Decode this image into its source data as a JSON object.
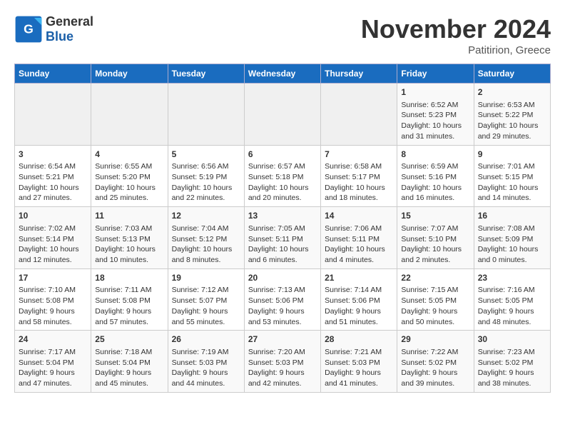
{
  "header": {
    "logo_general": "General",
    "logo_blue": "Blue",
    "month_title": "November 2024",
    "subtitle": "Patitirion, Greece"
  },
  "weekdays": [
    "Sunday",
    "Monday",
    "Tuesday",
    "Wednesday",
    "Thursday",
    "Friday",
    "Saturday"
  ],
  "weeks": [
    [
      {
        "day": "",
        "info": "",
        "empty": true
      },
      {
        "day": "",
        "info": "",
        "empty": true
      },
      {
        "day": "",
        "info": "",
        "empty": true
      },
      {
        "day": "",
        "info": "",
        "empty": true
      },
      {
        "day": "",
        "info": "",
        "empty": true
      },
      {
        "day": "1",
        "info": "Sunrise: 6:52 AM\nSunset: 5:23 PM\nDaylight: 10 hours and 31 minutes.",
        "empty": false
      },
      {
        "day": "2",
        "info": "Sunrise: 6:53 AM\nSunset: 5:22 PM\nDaylight: 10 hours and 29 minutes.",
        "empty": false
      }
    ],
    [
      {
        "day": "3",
        "info": "Sunrise: 6:54 AM\nSunset: 5:21 PM\nDaylight: 10 hours and 27 minutes.",
        "empty": false
      },
      {
        "day": "4",
        "info": "Sunrise: 6:55 AM\nSunset: 5:20 PM\nDaylight: 10 hours and 25 minutes.",
        "empty": false
      },
      {
        "day": "5",
        "info": "Sunrise: 6:56 AM\nSunset: 5:19 PM\nDaylight: 10 hours and 22 minutes.",
        "empty": false
      },
      {
        "day": "6",
        "info": "Sunrise: 6:57 AM\nSunset: 5:18 PM\nDaylight: 10 hours and 20 minutes.",
        "empty": false
      },
      {
        "day": "7",
        "info": "Sunrise: 6:58 AM\nSunset: 5:17 PM\nDaylight: 10 hours and 18 minutes.",
        "empty": false
      },
      {
        "day": "8",
        "info": "Sunrise: 6:59 AM\nSunset: 5:16 PM\nDaylight: 10 hours and 16 minutes.",
        "empty": false
      },
      {
        "day": "9",
        "info": "Sunrise: 7:01 AM\nSunset: 5:15 PM\nDaylight: 10 hours and 14 minutes.",
        "empty": false
      }
    ],
    [
      {
        "day": "10",
        "info": "Sunrise: 7:02 AM\nSunset: 5:14 PM\nDaylight: 10 hours and 12 minutes.",
        "empty": false
      },
      {
        "day": "11",
        "info": "Sunrise: 7:03 AM\nSunset: 5:13 PM\nDaylight: 10 hours and 10 minutes.",
        "empty": false
      },
      {
        "day": "12",
        "info": "Sunrise: 7:04 AM\nSunset: 5:12 PM\nDaylight: 10 hours and 8 minutes.",
        "empty": false
      },
      {
        "day": "13",
        "info": "Sunrise: 7:05 AM\nSunset: 5:11 PM\nDaylight: 10 hours and 6 minutes.",
        "empty": false
      },
      {
        "day": "14",
        "info": "Sunrise: 7:06 AM\nSunset: 5:11 PM\nDaylight: 10 hours and 4 minutes.",
        "empty": false
      },
      {
        "day": "15",
        "info": "Sunrise: 7:07 AM\nSunset: 5:10 PM\nDaylight: 10 hours and 2 minutes.",
        "empty": false
      },
      {
        "day": "16",
        "info": "Sunrise: 7:08 AM\nSunset: 5:09 PM\nDaylight: 10 hours and 0 minutes.",
        "empty": false
      }
    ],
    [
      {
        "day": "17",
        "info": "Sunrise: 7:10 AM\nSunset: 5:08 PM\nDaylight: 9 hours and 58 minutes.",
        "empty": false
      },
      {
        "day": "18",
        "info": "Sunrise: 7:11 AM\nSunset: 5:08 PM\nDaylight: 9 hours and 57 minutes.",
        "empty": false
      },
      {
        "day": "19",
        "info": "Sunrise: 7:12 AM\nSunset: 5:07 PM\nDaylight: 9 hours and 55 minutes.",
        "empty": false
      },
      {
        "day": "20",
        "info": "Sunrise: 7:13 AM\nSunset: 5:06 PM\nDaylight: 9 hours and 53 minutes.",
        "empty": false
      },
      {
        "day": "21",
        "info": "Sunrise: 7:14 AM\nSunset: 5:06 PM\nDaylight: 9 hours and 51 minutes.",
        "empty": false
      },
      {
        "day": "22",
        "info": "Sunrise: 7:15 AM\nSunset: 5:05 PM\nDaylight: 9 hours and 50 minutes.",
        "empty": false
      },
      {
        "day": "23",
        "info": "Sunrise: 7:16 AM\nSunset: 5:05 PM\nDaylight: 9 hours and 48 minutes.",
        "empty": false
      }
    ],
    [
      {
        "day": "24",
        "info": "Sunrise: 7:17 AM\nSunset: 5:04 PM\nDaylight: 9 hours and 47 minutes.",
        "empty": false
      },
      {
        "day": "25",
        "info": "Sunrise: 7:18 AM\nSunset: 5:04 PM\nDaylight: 9 hours and 45 minutes.",
        "empty": false
      },
      {
        "day": "26",
        "info": "Sunrise: 7:19 AM\nSunset: 5:03 PM\nDaylight: 9 hours and 44 minutes.",
        "empty": false
      },
      {
        "day": "27",
        "info": "Sunrise: 7:20 AM\nSunset: 5:03 PM\nDaylight: 9 hours and 42 minutes.",
        "empty": false
      },
      {
        "day": "28",
        "info": "Sunrise: 7:21 AM\nSunset: 5:03 PM\nDaylight: 9 hours and 41 minutes.",
        "empty": false
      },
      {
        "day": "29",
        "info": "Sunrise: 7:22 AM\nSunset: 5:02 PM\nDaylight: 9 hours and 39 minutes.",
        "empty": false
      },
      {
        "day": "30",
        "info": "Sunrise: 7:23 AM\nSunset: 5:02 PM\nDaylight: 9 hours and 38 minutes.",
        "empty": false
      }
    ]
  ]
}
